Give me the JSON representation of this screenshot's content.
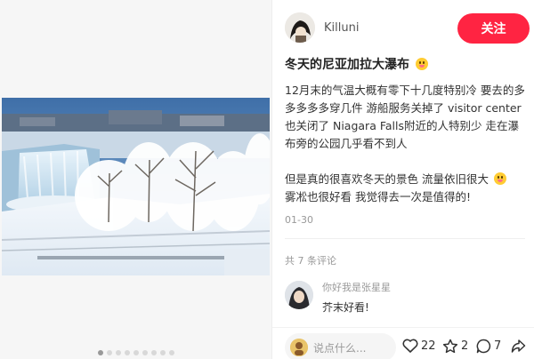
{
  "post": {
    "author_name": "Killuni",
    "follow_label": "关注",
    "title": "冬天的尼亚加拉大瀑布",
    "paragraphs": [
      "12月末的气温大概有零下十几度特别冷 要去的多多多多多穿几件 游船服务关掉了 visitor center也关闭了 Niagara Falls附近的人特别少 走在瀑布旁的公园几乎看不到人",
      "但是真的很喜欢冬天的景色 流量依旧很大",
      "雾凇也很好看 我觉得去一次是值得的!"
    ],
    "date": "01-30"
  },
  "comments": {
    "count_text": "共 7 条评论",
    "items": [
      {
        "name": "你好我是张星星",
        "text": "芥末好看!"
      }
    ]
  },
  "bottom_bar": {
    "input_placeholder": "说点什么...",
    "likes": "22",
    "stars": "2",
    "comments": "7"
  },
  "icons": [
    "smile-emoji-icon",
    "heart-icon",
    "star-icon",
    "comment-icon",
    "share-icon"
  ],
  "colors": {
    "accent": "#ff2442"
  }
}
